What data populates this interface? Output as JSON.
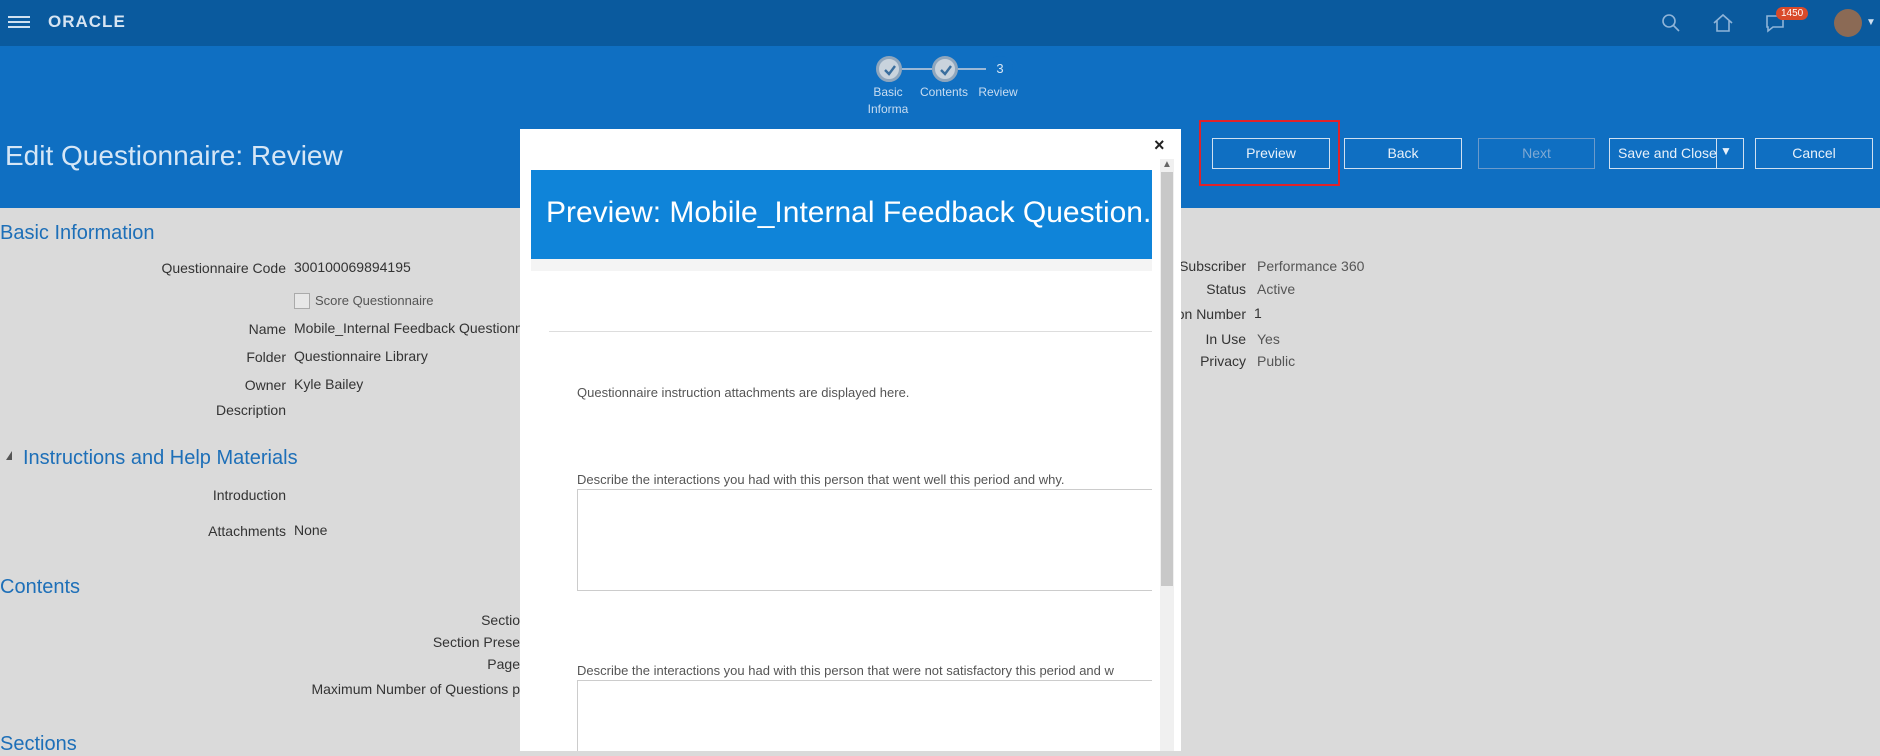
{
  "topbar": {
    "logo": "ORACLE",
    "notification_count": "1450",
    "icons": [
      "menu-icon",
      "search-icon",
      "home-icon",
      "notifications-icon",
      "user-avatar"
    ]
  },
  "train": {
    "steps": [
      {
        "label": "Basic Informa",
        "state": "complete"
      },
      {
        "label": "Contents",
        "state": "complete"
      },
      {
        "label": "Review",
        "state": "current",
        "number": "3"
      }
    ]
  },
  "header": {
    "title": "Edit Questionnaire: Review",
    "buttons": {
      "preview": "Preview",
      "back": "Back",
      "next": "Next",
      "save_close": "Save and Close",
      "cancel": "Cancel"
    }
  },
  "basic_info": {
    "section_title": "Basic Information",
    "questionnaire_code_label": "Questionnaire Code",
    "questionnaire_code": "300100069894195",
    "score_questionnaire_label": "Score Questionnaire",
    "name_label": "Name",
    "name": "Mobile_Internal Feedback Questionn",
    "folder_label": "Folder",
    "folder": "Questionnaire Library",
    "owner_label": "Owner",
    "owner": "Kyle Bailey",
    "description_label": "Description",
    "subscriber_label": "Subscriber",
    "subscriber": "Performance 360",
    "status_label": "Status",
    "status": "Active",
    "version_number_label": "on Number",
    "version_number": "1",
    "in_use_label": "In Use",
    "in_use": "Yes",
    "privacy_label": "Privacy",
    "privacy": "Public"
  },
  "instructions": {
    "section_title": "Instructions and Help Materials",
    "introduction_label": "Introduction",
    "attachments_label": "Attachments",
    "attachments": "None"
  },
  "contents": {
    "section_title": "Contents",
    "labels": [
      "Sectio",
      "Section Prese",
      "Page",
      "Maximum Number of Questions p"
    ]
  },
  "sections": {
    "section_title": "Sections"
  },
  "modal": {
    "title": "Preview: Mobile_Internal Feedback Question...",
    "close_symbol": "×",
    "instruction_text": "Questionnaire instruction attachments are displayed here.",
    "question_1": "Describe the interactions you had with this person that went well this period and why.",
    "question_2": "Describe the interactions you had with this person that were not satisfactory this period and w"
  },
  "colors": {
    "topbar": "#0a5a9e",
    "header": "#0f6fc2",
    "modal_header": "#0f84d9",
    "highlight": "#e0222a",
    "section_title": "#1d6fb8"
  }
}
